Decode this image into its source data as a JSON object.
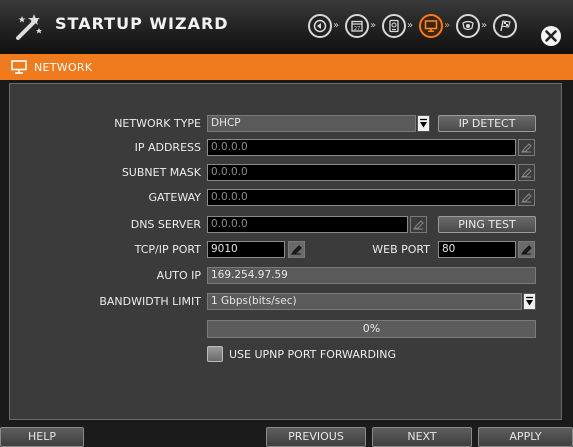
{
  "window": {
    "title": "STARTUP WIZARD",
    "steps": [
      {
        "icon": "language-icon",
        "active": false
      },
      {
        "icon": "calendar-icon",
        "active": false,
        "text": "27"
      },
      {
        "icon": "hdd-icon",
        "active": false
      },
      {
        "icon": "network-monitor-icon",
        "active": true
      },
      {
        "icon": "camera-icon",
        "active": false
      },
      {
        "icon": "finish-flag-icon",
        "active": false
      }
    ],
    "close_icon": "close-icon"
  },
  "section": {
    "icon": "monitor-icon",
    "title": "NETWORK"
  },
  "form": {
    "network_type": {
      "label": "NETWORK TYPE",
      "value": "DHCP",
      "action": "IP DETECT"
    },
    "ip_address": {
      "label": "IP ADDRESS",
      "value": "0.0.0.0"
    },
    "subnet_mask": {
      "label": "SUBNET MASK",
      "value": "0.0.0.0"
    },
    "gateway": {
      "label": "GATEWAY",
      "value": "0.0.0.0"
    },
    "dns_server": {
      "label": "DNS SERVER",
      "value": "0.0.0.0",
      "action": "PING TEST"
    },
    "tcpip_port": {
      "label": "TCP/IP PORT",
      "value": "9010"
    },
    "web_port": {
      "label": "WEB PORT",
      "value": "80"
    },
    "auto_ip": {
      "label": "AUTO IP",
      "value": "169.254.97.59"
    },
    "bandwidth_limit": {
      "label": "BANDWIDTH LIMIT",
      "value": "1 Gbps(bits/sec)"
    },
    "progress": {
      "text": "0%",
      "value": 0
    },
    "upnp": {
      "label": "USE UPNP PORT FORWARDING",
      "checked": false
    }
  },
  "footer": {
    "help": "HELP",
    "previous": "PREVIOUS",
    "next": "NEXT",
    "apply": "APPLY"
  },
  "colors": {
    "accent": "#f07a1e",
    "background": "#1a1a1a",
    "panel": "#3b3b3b"
  }
}
